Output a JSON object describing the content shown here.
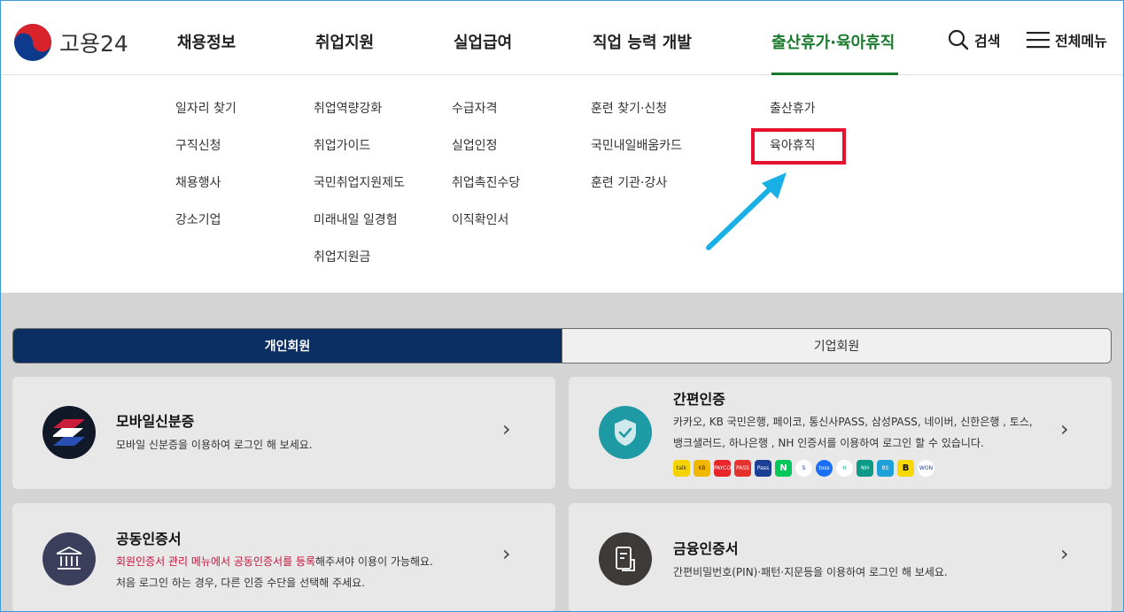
{
  "header": {
    "logo_text": "고용24",
    "nav": [
      "채용정보",
      "취업지원",
      "실업급여",
      "직업 능력 개발",
      "출산휴가·육아휴직"
    ],
    "search_label": "검색",
    "menu_label": "전체메뉴",
    "active_color": "#1a7a2e"
  },
  "mega_menu": {
    "col1": [
      "일자리 찾기",
      "구직신청",
      "채용행사",
      "강소기업"
    ],
    "col2": [
      "취업역량강화",
      "취업가이드",
      "국민취업지원제도",
      "미래내일 일경험",
      "취업지원금"
    ],
    "col3": [
      "수급자격",
      "실업인정",
      "취업촉진수당",
      "이직확인서"
    ],
    "col4": [
      "훈련 찾기·신청",
      "국민내일배움카드",
      "훈련 기관·강사"
    ],
    "col5": [
      "출산휴가",
      "육아휴직"
    ]
  },
  "annotation": {
    "highlight_color": "#e8112d",
    "arrow_color": "#19b0e6"
  },
  "login": {
    "tabs": [
      "개인회원",
      "기업회원"
    ],
    "mobile": {
      "title": "모바일신분증",
      "desc": "모바일 신분증을 이용하여 로그인 해 보세요."
    },
    "simple": {
      "title": "간편인증",
      "desc1": "카카오, KB 국민은행, 페이코, 통신사PASS, 삼성PASS, 네이버, 신한은행 , 토스,",
      "desc2": "뱅크샐러드, 하나은행 , NH 인증서를 이용하여 로그인 할 수 있습니다.",
      "badges": [
        "talk",
        "KB",
        "PAYCO",
        "PASS",
        "Pass",
        "N",
        "S",
        "toss",
        "H",
        "NH",
        "BS",
        "B",
        "WON"
      ]
    },
    "joint": {
      "title": "공동인증서",
      "desc_red": "회원인증서 관리 메뉴에서 공동인증서를 등록",
      "desc_rest": "해주셔야 이용이 가능해요.",
      "desc2": "처음 로그인 하는 경우, 다른 인증 수단을 선택해 주세요."
    },
    "finance": {
      "title": "금융인증서",
      "desc": "간편비밀번호(PIN)·패턴·지문등을 이용하여 로그인 해 보세요."
    },
    "chevron": "›"
  }
}
